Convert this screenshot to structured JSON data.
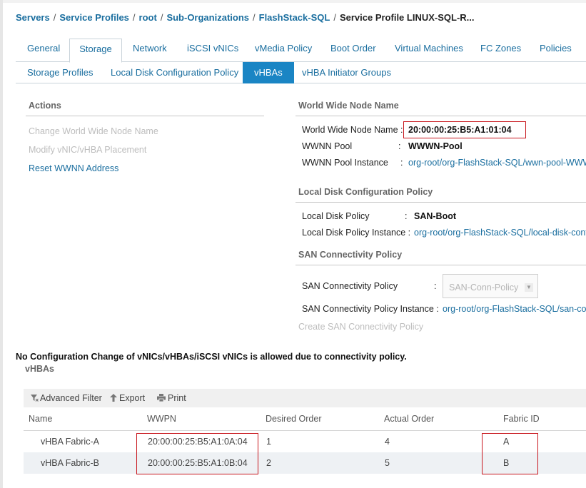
{
  "breadcrumb": {
    "items": [
      "Servers",
      "Service Profiles",
      "root",
      "Sub-Organizations",
      "FlashStack-SQL"
    ],
    "separator": "/",
    "current": "Service Profile LINUX-SQL-R..."
  },
  "tabs_main": [
    "General",
    "Storage",
    "Network",
    "iSCSI vNICs",
    "vMedia Policy",
    "Boot Order",
    "Virtual Machines",
    "FC Zones",
    "Policies"
  ],
  "tabs_main_active": "Storage",
  "tabs_sub": [
    "Storage Profiles",
    "Local Disk Configuration Policy",
    "vHBAs",
    "vHBA Initiator Groups"
  ],
  "tabs_sub_active": "vHBAs",
  "actions": {
    "title": "Actions",
    "items": [
      "Change World Wide Node Name",
      "Modify vNIC/vHBA Placement",
      "Reset WWNN Address"
    ]
  },
  "wwnn": {
    "title": "World Wide Node Name",
    "node_name_label": "World Wide Node Name :",
    "node_name_value": "20:00:00:25:B5:A1:01:04",
    "pool_label": "WWNN Pool",
    "pool_value": "WWWN-Pool",
    "pool_instance_label": "WWNN Pool Instance",
    "pool_instance_value": "org-root/org-FlashStack-SQL/wwn-pool-WWWN-Pool"
  },
  "local_disk": {
    "title": "Local Disk Configuration Policy",
    "policy_label": "Local Disk Policy",
    "policy_value": "SAN-Boot",
    "instance_label": "Local Disk Policy Instance :",
    "instance_value": "org-root/org-FlashStack-SQL/local-disk-config-SAN-Boot"
  },
  "san": {
    "title": "SAN Connectivity Policy",
    "policy_label": "SAN Connectivity Policy",
    "policy_selected": "SAN-Conn-Policy",
    "instance_label": "SAN Connectivity Policy Instance :",
    "instance_value": "org-root/org-FlashStack-SQL/san-conn-pol-SAN-Conn-Policy",
    "create_link": "Create SAN Connectivity Policy"
  },
  "colon": ":",
  "warning": "No Configuration Change of vNICs/vHBAs/iSCSI vNICs is allowed due to connectivity policy.",
  "vhbas": {
    "title": "vHBAs",
    "toolbar": {
      "filter": "Advanced Filter",
      "export": "Export",
      "print": "Print"
    },
    "columns": [
      "Name",
      "WWPN",
      "Desired Order",
      "Actual Order",
      "Fabric ID"
    ],
    "rows": [
      [
        "vHBA Fabric-A",
        "20:00:00:25:B5:A1:0A:04",
        "1",
        "4",
        "A"
      ],
      [
        "vHBA Fabric-B",
        "20:00:00:25:B5:A1:0B:04",
        "2",
        "5",
        "B"
      ]
    ]
  },
  "icons": {
    "filter": "filter-icon",
    "export": "upload-arrow-icon",
    "print": "printer-icon",
    "caret": "chevron-down-icon"
  },
  "colors": {
    "link": "#1a6e9f",
    "active_tab": "#1a85c4",
    "highlight": "#c8161d"
  }
}
